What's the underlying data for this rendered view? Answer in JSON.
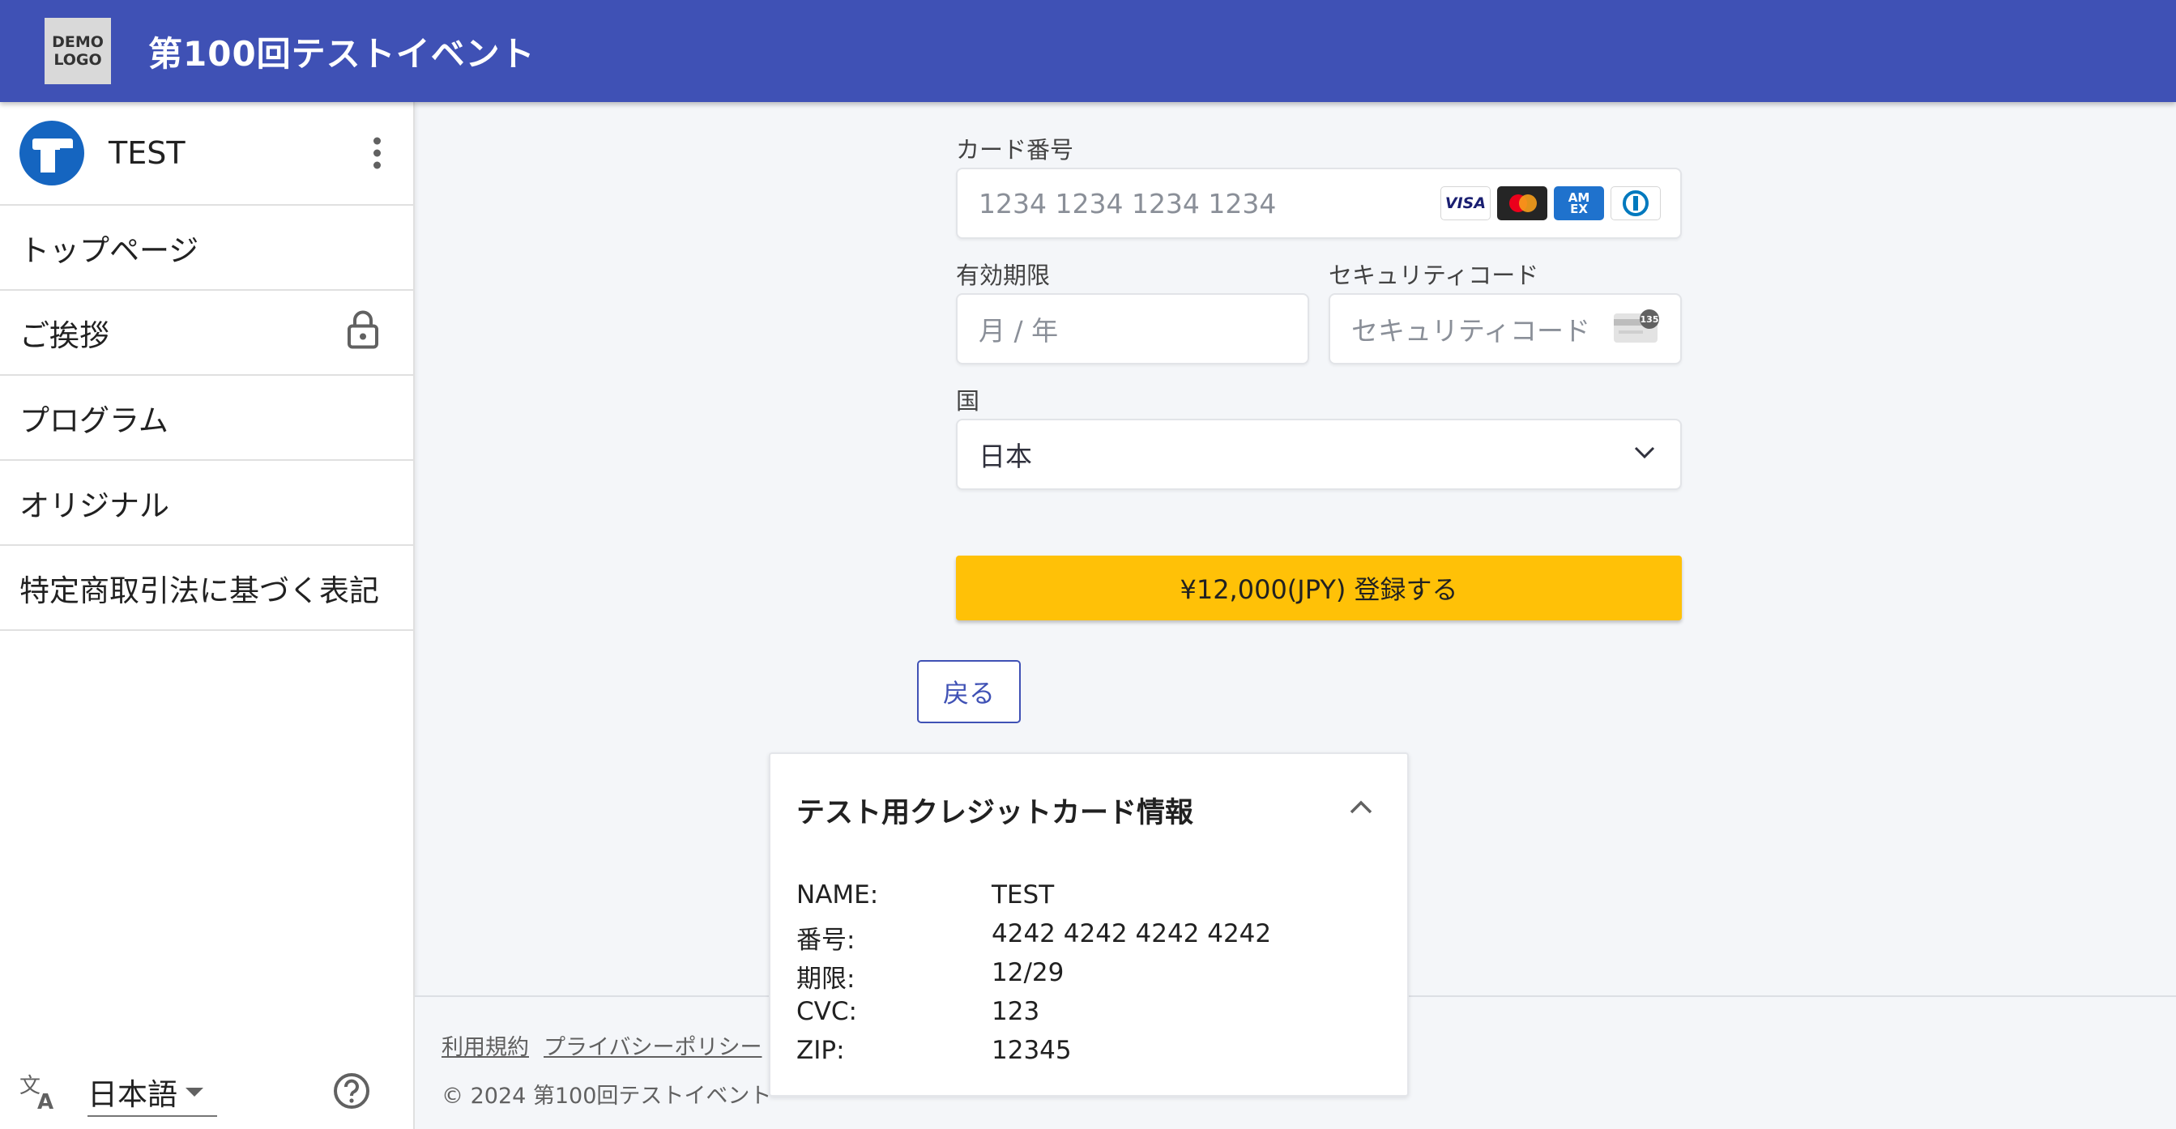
{
  "header": {
    "logo_line1": "DEMO",
    "logo_line2": "LOGO",
    "title": "第100回テストイベント",
    "color": "#3f51b5"
  },
  "sidebar": {
    "user_name": "TEST",
    "items": [
      {
        "label": "トップページ"
      },
      {
        "label": "ご挨拶",
        "locked": true
      },
      {
        "label": "プログラム"
      },
      {
        "label": "オリジナル"
      },
      {
        "label": "特定商取引法に基づく表記"
      }
    ],
    "language": "日本語"
  },
  "form": {
    "card_number_label": "カード番号",
    "card_number_placeholder": "1234 1234 1234 1234",
    "brands": [
      "VISA",
      "Mastercard",
      "American Express",
      "Diners Club"
    ],
    "amex_text_line1": "AM",
    "amex_text_line2": "EX",
    "visa_text": "VISA",
    "expiry_label": "有効期限",
    "expiry_placeholder": "月 / 年",
    "cvc_label": "セキュリティコード",
    "cvc_placeholder": "セキュリティコード",
    "cvc_icon_text": "135",
    "country_label": "国",
    "country_value": "日本",
    "submit_label": "¥12,000(JPY) 登録する",
    "submit_color": "#ffc107",
    "back_label": "戻る"
  },
  "test_card": {
    "title": "テスト用クレジットカード情報",
    "rows": [
      {
        "key": "NAME:",
        "value": "TEST"
      },
      {
        "key": "番号:",
        "value": "4242 4242 4242 4242"
      },
      {
        "key": "期限:",
        "value": "12/29"
      },
      {
        "key": "CVC:",
        "value": "123"
      },
      {
        "key": "ZIP:",
        "value": "12345"
      }
    ]
  },
  "footer": {
    "links": [
      "利用規約",
      "プライバシーポリシー"
    ],
    "copyright": "© 2024 第100回テストイベント"
  }
}
